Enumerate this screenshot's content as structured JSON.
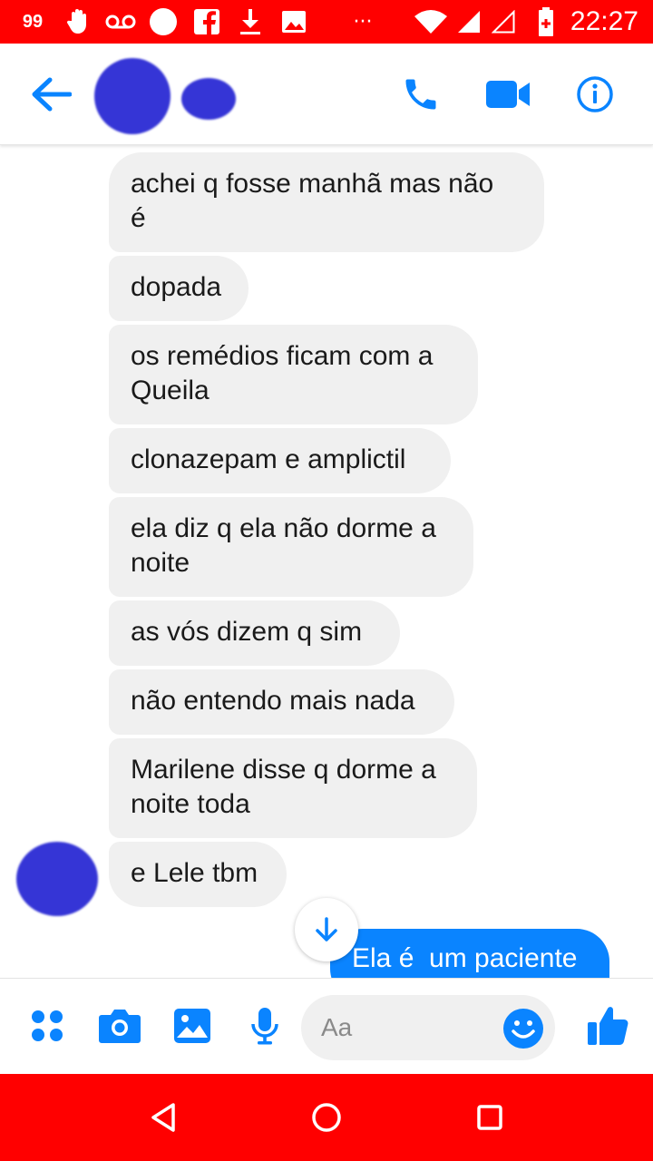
{
  "status_bar": {
    "time": "22:27",
    "notification_badge": "99",
    "background": "#ff0000",
    "left_icons": [
      "messenger-badge-icon",
      "hand-icon",
      "voicemail-icon",
      "circle-icon",
      "facebook-icon",
      "download-icon",
      "image-icon",
      "more-icon"
    ],
    "right_icons": [
      "wifi-icon",
      "signal-icon",
      "signal-empty-icon",
      "battery-icon"
    ],
    "more_glyph": "···"
  },
  "header": {
    "contact_name_redacted": true,
    "icons": [
      "back-arrow-icon",
      "phone-icon",
      "video-icon",
      "info-icon"
    ],
    "accent": "#0a84ff"
  },
  "messages": {
    "incoming": [
      "achei q fosse manhã mas não\né",
      "dopada",
      "os remédios ficam com a\nQueila",
      "clonazepam e amplictil",
      "ela diz q ela não dorme a\nnoite",
      "as vós dizem q sim",
      "não entendo mais nada",
      "Marilene disse q dorme a\nnoite toda",
      "e Lele tbm"
    ],
    "outgoing": [
      "Ela é  um paciente"
    ],
    "incoming_bubble_color": "#f0f0f0",
    "outgoing_bubble_color": "#0a84ff"
  },
  "composer": {
    "placeholder": "Aa",
    "icons": [
      "more-apps-icon",
      "camera-icon",
      "gallery-icon",
      "microphone-icon",
      "emoji-icon",
      "thumbs-up-icon"
    ]
  },
  "nav_bar": {
    "background": "#ff0000",
    "icons": [
      "back-triangle-icon",
      "home-circle-icon",
      "recents-square-icon"
    ]
  }
}
